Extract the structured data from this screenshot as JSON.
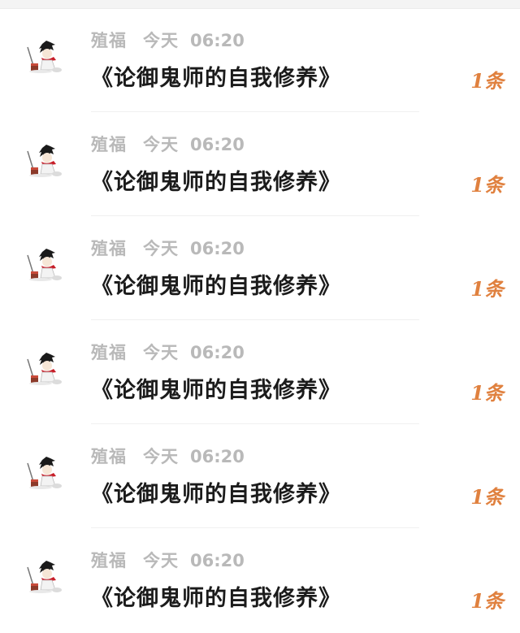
{
  "messages": [
    {
      "sender": "殖福",
      "day": "今天",
      "time": "06:20",
      "title": "《论御鬼师的自我修养》",
      "count": "1条",
      "avatar_icon": "anime-boy-avatar-icon"
    },
    {
      "sender": "殖福",
      "day": "今天",
      "time": "06:20",
      "title": "《论御鬼师的自我修养》",
      "count": "1条",
      "avatar_icon": "anime-boy-avatar-icon"
    },
    {
      "sender": "殖福",
      "day": "今天",
      "time": "06:20",
      "title": "《论御鬼师的自我修养》",
      "count": "1条",
      "avatar_icon": "anime-boy-avatar-icon"
    },
    {
      "sender": "殖福",
      "day": "今天",
      "time": "06:20",
      "title": "《论御鬼师的自我修养》",
      "count": "1条",
      "avatar_icon": "anime-boy-avatar-icon"
    },
    {
      "sender": "殖福",
      "day": "今天",
      "time": "06:20",
      "title": "《论御鬼师的自我修养》",
      "count": "1条",
      "avatar_icon": "anime-boy-avatar-icon"
    },
    {
      "sender": "殖福",
      "day": "今天",
      "time": "06:20",
      "title": "《论御鬼师的自我修养》",
      "count": "1条",
      "avatar_icon": "anime-boy-avatar-icon"
    }
  ],
  "colors": {
    "meta_text": "#b9b9b9",
    "title_text": "#1b1b1b",
    "count_accent": "#e0813f"
  }
}
